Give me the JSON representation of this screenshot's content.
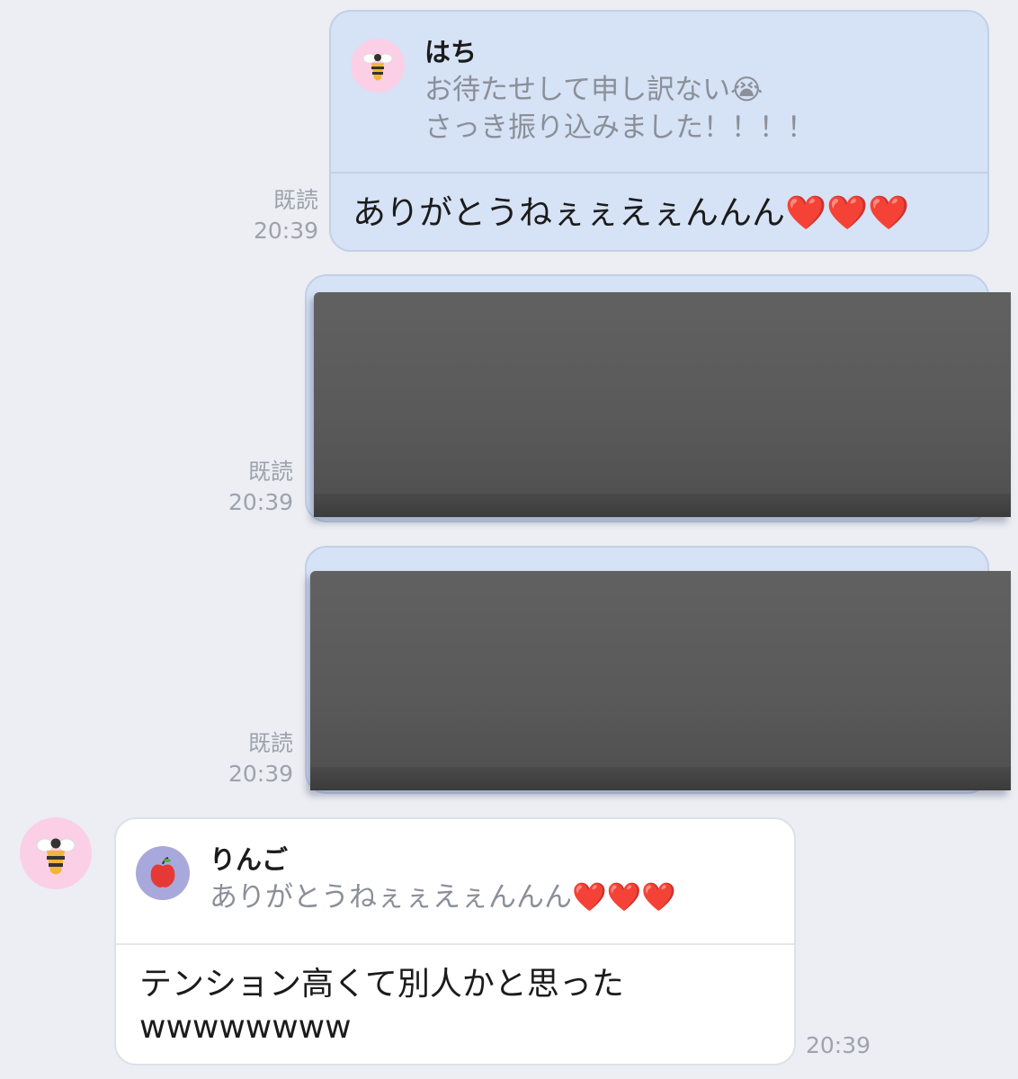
{
  "messages": {
    "out1": {
      "read": "既読",
      "time": "20:39",
      "quote": {
        "name": "はち",
        "text": "お待たせして申し訳ない😭\nさっき振り込みました！！！！"
      },
      "text": "ありがとうねぇぇえぇんんん❤️❤️❤️"
    },
    "out2": {
      "read": "既読",
      "time": "20:39",
      "type": "image"
    },
    "out3": {
      "read": "既読",
      "time": "20:39",
      "type": "image"
    },
    "in1": {
      "time": "20:39",
      "quote": {
        "name": "りんご",
        "text": "ありがとうねぇぇえぇんんん❤️❤️❤️"
      },
      "text": "テンション高くて別人かと思った\nwwwwwwww"
    }
  },
  "avatars": {
    "bee": "bee-icon",
    "apple": "apple-icon"
  },
  "colors": {
    "background": "#eceef3",
    "outgoing_bubble": "#d6e2f5",
    "incoming_bubble": "#ffffff",
    "avatar_pink": "#fbd0e6",
    "avatar_purple": "#a9a8dc"
  }
}
